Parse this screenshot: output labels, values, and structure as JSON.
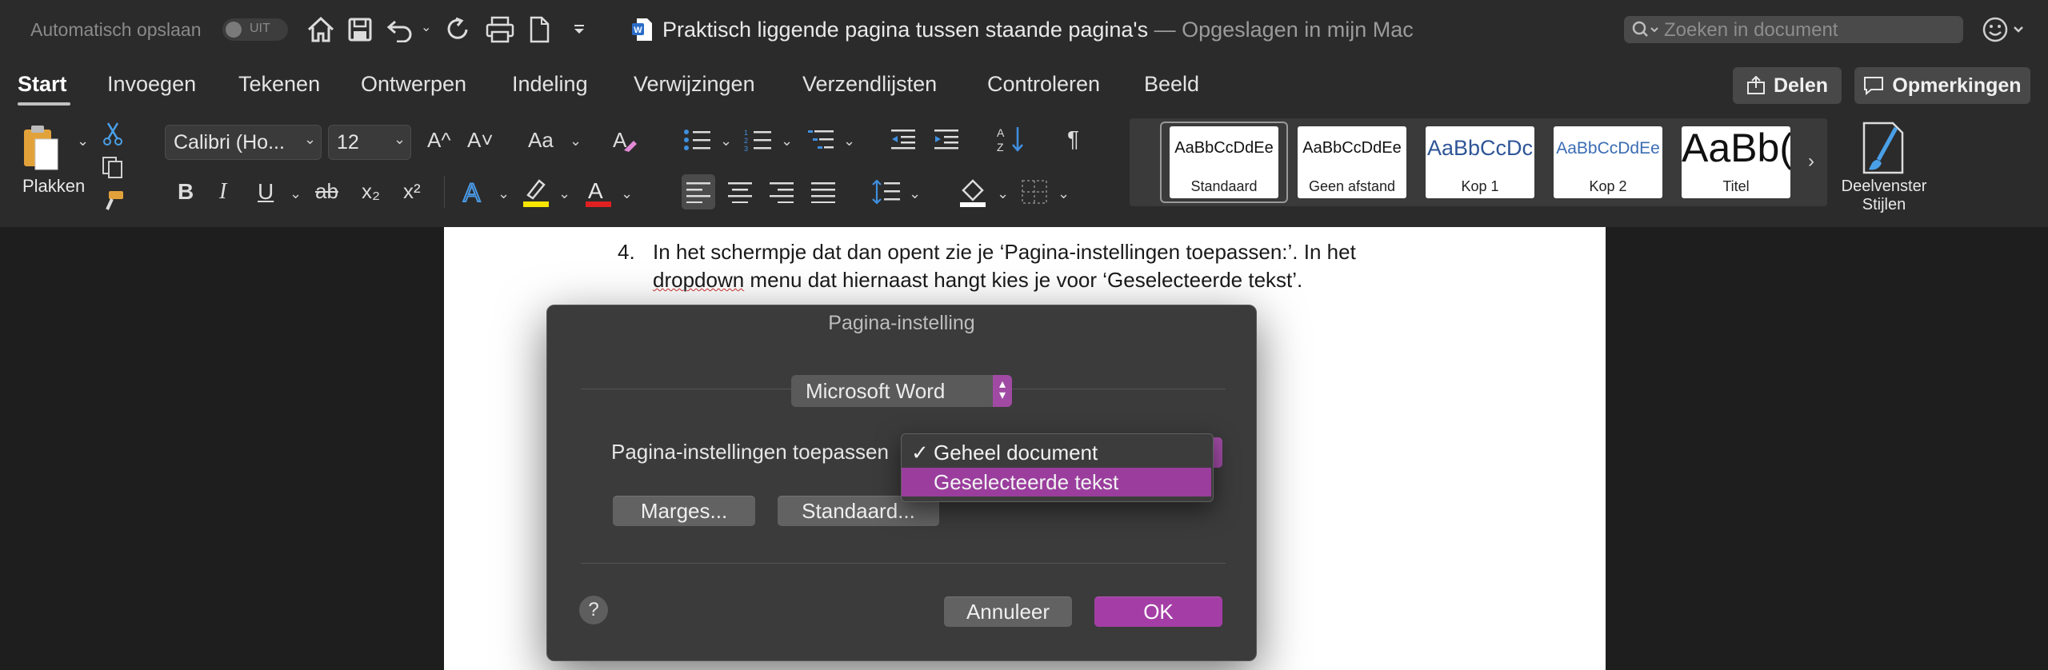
{
  "titlebar": {
    "autosave_label": "Automatisch opslaan",
    "autosave_toggle": "UIT",
    "doc_title": "Praktisch liggende pagina tussen staande pagina's",
    "doc_subtitle": "— Opgeslagen in mijn Mac",
    "search_placeholder": "Zoeken in document"
  },
  "tabs": [
    "Start",
    "Invoegen",
    "Tekenen",
    "Ontwerpen",
    "Indeling",
    "Verwijzingen",
    "Verzendlijsten",
    "Controleren",
    "Beeld"
  ],
  "top_buttons": {
    "share": "Delen",
    "comments": "Opmerkingen"
  },
  "ribbon": {
    "paste_label": "Plakken",
    "font_name": "Calibri (Ho...",
    "font_size": "12",
    "grow_font": "A^",
    "shrink_font": "A˅",
    "change_case": "Aa",
    "bold": "B",
    "italic": "I",
    "underline": "U",
    "strike": "ab",
    "subscript": "x₂",
    "superscript": "x²",
    "pilcrow": "¶",
    "styles": [
      {
        "sample": "AaBbCcDdEe",
        "name": "Standaard"
      },
      {
        "sample": "AaBbCcDdEe",
        "name": "Geen afstand"
      },
      {
        "sample": "AaBbCcDc",
        "name": "Kop 1"
      },
      {
        "sample": "AaBbCcDdEe",
        "name": "Kop 2"
      },
      {
        "sample": "AaBb(",
        "name": "Titel"
      }
    ],
    "styles_pane_line1": "Deelvenster",
    "styles_pane_line2": "Stijlen"
  },
  "document": {
    "list_number": "4.",
    "line1": "In het schermpje dat dan opent zie je ‘Pagina-instellingen toepassen:’. In het",
    "line2_squiggle": "dropdown",
    "line2_rest": " menu dat hiernaast hangt kies je voor ‘Geselecteerde tekst’."
  },
  "dialog": {
    "title": "Pagina-instelling",
    "app_popup": "Microsoft Word",
    "apply_label": "Pagina-instellingen toepassen",
    "margins_button": "Marges...",
    "default_button": "Standaard...",
    "help": "?",
    "cancel_button": "Annuleer",
    "ok_button": "OK",
    "menu_items": [
      {
        "label": "Geheel document",
        "checked": true
      },
      {
        "label": "Geselecteerde tekst",
        "checked": false
      }
    ],
    "checkmark": "✓"
  },
  "colors": {
    "accent": "#a43ea6",
    "chrome": "#2b2b2b",
    "font_red": "#e02020",
    "highlight_yellow": "#f7e600",
    "blue_icon": "#3f8fe0"
  },
  "icons": [
    "home-icon",
    "save-icon",
    "undo-icon",
    "redo-icon",
    "print-icon",
    "new-doc-icon",
    "customize-chevron-icon",
    "word-doc-icon",
    "search-icon",
    "smiley-icon"
  ]
}
